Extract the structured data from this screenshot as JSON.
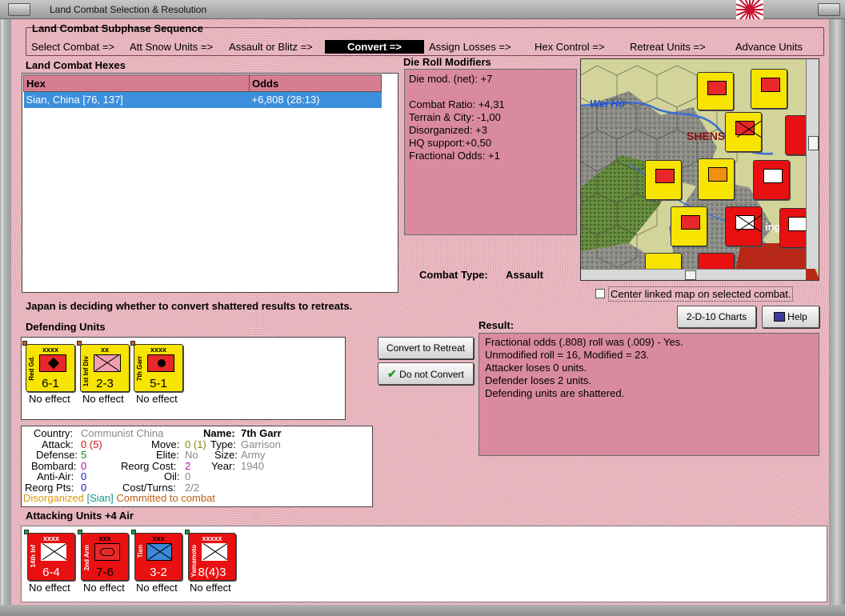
{
  "window": {
    "title": "Land Combat Selection & Resolution"
  },
  "subphase": {
    "heading": "Land Combat Subphase Sequence",
    "steps": [
      "Select Combat =>",
      "Att Snow Units =>",
      "Assault or Blitz =>",
      "Convert =>",
      "Assign Losses =>",
      "Hex Control =>",
      "Retreat Units =>",
      "Advance Units"
    ],
    "active": "Convert =>"
  },
  "hexes": {
    "heading": "Land Combat Hexes",
    "columns": [
      "Hex",
      "Odds"
    ],
    "rows": [
      {
        "hex": "Sian, China [76, 137]",
        "odds": "+6,808 (28:13)"
      }
    ]
  },
  "drm": {
    "heading": "Die Roll Modifiers",
    "lines": [
      "Die mod. (net): +7",
      "",
      "Combat Ratio: +4,31",
      "Terrain & City: -1,00",
      "Disorganized: +3",
      "HQ support:+0,50",
      "Fractional Odds: +1"
    ]
  },
  "combat_type": {
    "label": "Combat Type:",
    "value": "Assault"
  },
  "map": {
    "labels": {
      "river": "Wei Ho",
      "region": "SHENS",
      "city": "ing"
    },
    "checkbox_label": "Center linked map on selected combat."
  },
  "status_message": "Japan is deciding whether to convert shattered results to retreats.",
  "buttons": {
    "charts": "2-D-10 Charts",
    "help": "Help",
    "convert": "Convert to Retreat",
    "no_convert": "Do not Convert"
  },
  "defending": {
    "heading": "Defending Units",
    "units": [
      {
        "name": "Red Gd.",
        "size": "xxxx",
        "value": "6-1",
        "effect": "No effect"
      },
      {
        "name": "1st Inf Div",
        "size": "xx",
        "value": "2-3",
        "effect": "No effect"
      },
      {
        "name": "7th Garr",
        "size": "xxxx",
        "value": "5-1",
        "effect": "No effect"
      }
    ]
  },
  "result": {
    "heading": "Result:",
    "lines": [
      "Fractional odds (.808) roll was (.009)  - Yes.",
      "Unmodified roll = 16, Modified = 23.",
      "Attacker loses 0 units.",
      "Defender loses 2 units.",
      "Defending units are shattered."
    ]
  },
  "unit_info": {
    "country_label": "Country:",
    "country": "Communist China",
    "name_label": "Name:",
    "name": "7th Garr",
    "attack_label": "Attack:",
    "attack": "0",
    "attack_paren": "(5)",
    "defense_label": "Defense:",
    "defense": "5",
    "bombard_label": "Bombard:",
    "bombard": "0",
    "antiair_label": "Anti-Air:",
    "antiair": "0",
    "reorg_label": "Reorg Pts:",
    "reorg": "0",
    "move_label": "Move:",
    "move": "0",
    "move_paren": "(1)",
    "elite_label": "Elite:",
    "elite": "No",
    "reorg_cost_label": "Reorg Cost:",
    "reorg_cost": "2",
    "oil_label": "Oil:",
    "oil": "0",
    "cost_turns_label": "Cost/Turns:",
    "cost_turns": "2/2",
    "type_label": "Type:",
    "type": "Garrison",
    "size_label": "Size:",
    "size": "Army",
    "year_label": "Year:",
    "year": "1940",
    "status1": "Disorganized",
    "status2": "[Sian]",
    "status3": "Committed to combat"
  },
  "attacking": {
    "heading": "Attacking Units +4 Air",
    "units": [
      {
        "name": "14th Inf",
        "size": "xxxx",
        "value": "6-4",
        "effect": "No effect"
      },
      {
        "name": "2nd Arm",
        "size": "xxx",
        "value": "7-6",
        "effect": "No effect"
      },
      {
        "name": "Tien",
        "size": "xxx",
        "value": "3-2",
        "effect": "No effect"
      },
      {
        "name": "Yamamoto",
        "size": "xxxxx",
        "value": "8(4)3",
        "effect": "No effect"
      }
    ]
  },
  "colors": {
    "accent_pink": "#e8b8c0",
    "selected_row": "#3c8fdc",
    "japan_red": "#e81010",
    "china_yellow": "#f7e400"
  }
}
